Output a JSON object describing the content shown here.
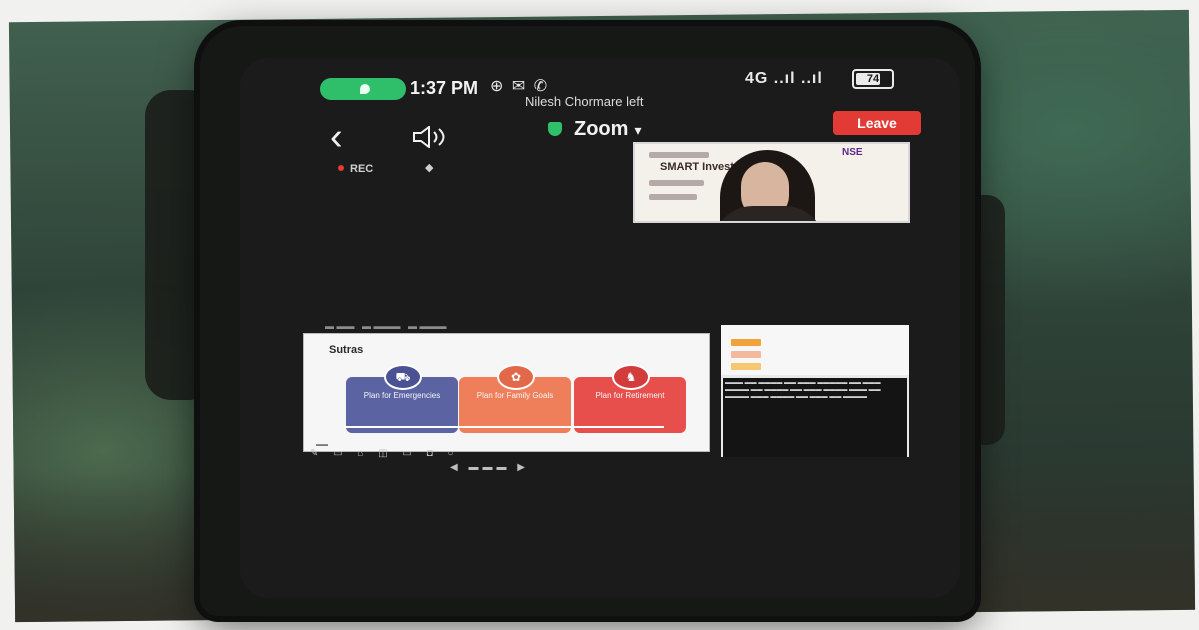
{
  "status_bar": {
    "time": "1:37 PM",
    "battery": "74",
    "signal_text": "4G ..ıl ..ıl",
    "notification": "Nilesh Chormare left"
  },
  "toolbar": {
    "app_title": "Zoom",
    "leave_label": "Leave",
    "rec_label": "REC"
  },
  "video": {
    "slide_title": "SMART Investors Program",
    "slide_logo": "NSE"
  },
  "shared_slide": {
    "title": "Sutras",
    "cards": [
      {
        "label": "Plan for Emergencies",
        "color": "#5b63a3",
        "icon": "car-icon"
      },
      {
        "label": "Plan for Family Goals",
        "color": "#ef7e5a",
        "icon": "family-icon"
      },
      {
        "label": "Plan for Retirement",
        "color": "#e74f4c",
        "icon": "retirement-icon"
      }
    ]
  },
  "colors": {
    "accent_green": "#2fbf6b",
    "leave_red": "#e23b36"
  }
}
